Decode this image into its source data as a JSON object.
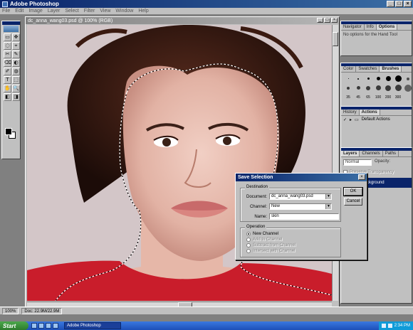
{
  "app": {
    "title": "Adobe Photoshop"
  },
  "menu": [
    "File",
    "Edit",
    "Image",
    "Layer",
    "Select",
    "Filter",
    "View",
    "Window",
    "Help"
  ],
  "document": {
    "title": "dc_anna_wang03.psd @ 100% (RGB)"
  },
  "tools": [
    "▭",
    "✥",
    "◌",
    "⌖",
    "✂",
    "✎",
    "⌫",
    "◐",
    "✐",
    "◍",
    "T",
    "⬚",
    "✋",
    "🔍",
    "◧",
    "◨"
  ],
  "palettes": {
    "navigator": {
      "tabs": [
        "Navigator",
        "Info",
        "Options"
      ],
      "message": "No options for the Hand Tool"
    },
    "brushes": {
      "tabs": [
        "Color",
        "Swatches",
        "Brushes"
      ],
      "sizes": [
        "35",
        "45",
        "65",
        "100",
        "200",
        "300"
      ]
    },
    "actions": {
      "tabs": [
        "History",
        "Actions"
      ],
      "item": "Default Actions"
    },
    "layers": {
      "tabs": [
        "Layers",
        "Channels",
        "Paths"
      ],
      "mode": "Normal",
      "opacity_label": "Opacity:",
      "preserve": "Preserve Transparency",
      "layer_name": "Background"
    }
  },
  "status": {
    "zoom": "100%",
    "doc": "Doc: 22.9M/22.9M"
  },
  "dialog": {
    "title": "Save Selection",
    "destination_label": "Destination",
    "document_label": "Document:",
    "document_value": "dc_anna_wang03.psd",
    "channel_label": "Channel:",
    "channel_value": "New",
    "name_label": "Name:",
    "name_value": "skin",
    "operation_label": "Operation",
    "operations": [
      "New Channel",
      "Add to Channel",
      "Subtract from Channel",
      "Intersect with Channel"
    ],
    "ok": "OK",
    "cancel": "Cancel"
  },
  "taskbar": {
    "start": "Start",
    "task": "Adobe Photoshop",
    "clock": "2:34 PM"
  },
  "colors": {
    "title_blue": "#0a246a",
    "canvas_bg": "#d3c6c8",
    "taskbar_blue": "#1d4fb8",
    "start_green": "#2c7a2c"
  }
}
